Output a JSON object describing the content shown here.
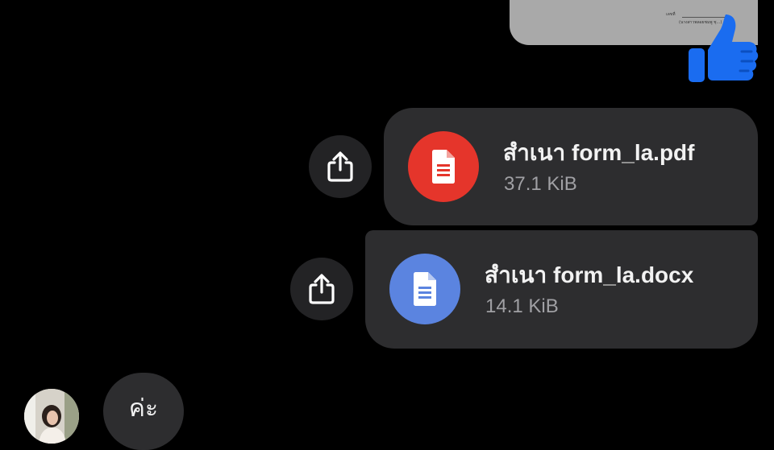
{
  "image_message": {
    "caption_line_1": "เลขที่",
    "caption_line_2": "(นางสาวพลอยชมพู ชุ...)"
  },
  "reaction": {
    "icon": "thumbs-up-icon",
    "color": "#1a6cf0"
  },
  "attachments": [
    {
      "name": "สำเนา form_la.pdf",
      "size": "37.1 KiB",
      "icon": "pdf-document-icon",
      "color": "#e5352b"
    },
    {
      "name": "สำเนา form_la.docx",
      "size": "14.1 KiB",
      "icon": "word-document-icon",
      "color": "#5b84e0"
    }
  ],
  "reply": {
    "text": "ค่ะ"
  }
}
